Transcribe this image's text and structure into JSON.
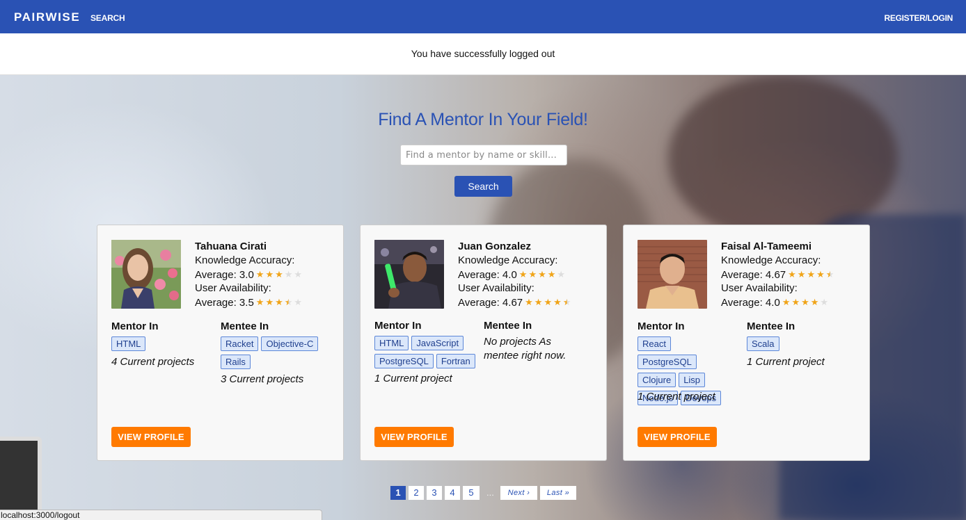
{
  "navbar": {
    "brand": "PAIRWISE",
    "search": "SEARCH",
    "register": "REGISTER/LOGIN"
  },
  "flash": {
    "message": "You have successfully logged out"
  },
  "hero": {
    "title": "Find A Mentor In Your Field!",
    "search_placeholder": "Find a mentor by name or skill...",
    "search_button": "Search"
  },
  "labels": {
    "knowledge": "Knowledge Accuracy:",
    "availability": "User Availability:",
    "mentor_in": "Mentor In",
    "mentee_in": "Mentee In",
    "view_profile": "VIEW PROFILE"
  },
  "mentors": [
    {
      "name": "Tahuana Cirati",
      "knowledge_avg": "Average: 3.0",
      "knowledge_stars": 3.0,
      "availability_avg": "Average: 3.5",
      "availability_stars": 3.5,
      "mentor_tags": [
        "HTML"
      ],
      "mentor_projects": "4 Current projects",
      "mentee_tags": [
        "Racket",
        "Objective-C",
        "Rails"
      ],
      "mentee_projects": "3 Current projects"
    },
    {
      "name": "Juan Gonzalez",
      "knowledge_avg": "Average: 4.0",
      "knowledge_stars": 4.0,
      "availability_avg": "Average: 4.67",
      "availability_stars": 4.5,
      "mentor_tags": [
        "HTML",
        "JavaScript",
        "PostgreSQL",
        "Fortran"
      ],
      "mentor_projects": "1 Current project",
      "mentee_tags": [],
      "mentee_projects": "No projects As mentee right now."
    },
    {
      "name": "Faisal Al-Tameemi",
      "knowledge_avg": "Average: 4.67",
      "knowledge_stars": 4.5,
      "availability_avg": "Average: 4.0",
      "availability_stars": 4.0,
      "mentor_tags": [
        "React",
        "PostgreSQL",
        "Clojure",
        "Lisp",
        "Node.js",
        "Devops"
      ],
      "mentor_projects": "1 Current project",
      "mentee_tags": [
        "Scala"
      ],
      "mentee_projects": "1 Current project"
    }
  ],
  "pagination": {
    "pages": [
      "1",
      "2",
      "3",
      "4",
      "5"
    ],
    "current": "1",
    "ellipsis": "...",
    "next": "Next ›",
    "last": "Last »"
  },
  "statusbar": {
    "url": "localhost:3000/logout"
  },
  "colors": {
    "brand": "#2a52b4",
    "accent": "#ff7a00",
    "star": "#f0a418"
  }
}
